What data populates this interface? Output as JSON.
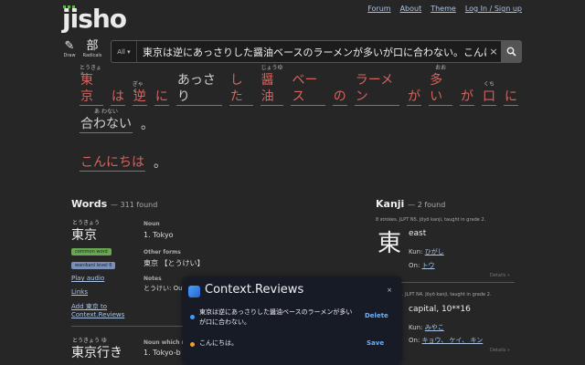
{
  "header": {
    "logo": "jisho",
    "nav": [
      "Forum",
      "About",
      "Theme",
      "Log In / Sign up"
    ],
    "draw_label": "Draw",
    "radicals_label": "Radicals",
    "draw_icon": "✎",
    "radicals_icon": "部"
  },
  "search": {
    "selector": "All ▾",
    "query": "東京は逆にあっさりした醤油ベースのラーメンが多いが口に合わない。こんにちは。",
    "clear": "×"
  },
  "sentence": {
    "line1": [
      {
        "furi": "とうきょう",
        "w": "東京",
        "style": "red"
      },
      {
        "furi": "",
        "w": "は",
        "style": "red"
      },
      {
        "furi": "ぎゃく",
        "w": "逆",
        "style": "red"
      },
      {
        "furi": "",
        "w": "に",
        "style": "red"
      },
      {
        "furi": "",
        "w": "あっさり",
        "style": "grey"
      },
      {
        "furi": "",
        "w": "した",
        "style": "red"
      },
      {
        "furi": "じょうゆ",
        "w": "醤油",
        "style": "red"
      },
      {
        "furi": "",
        "w": "ベース",
        "style": "red"
      },
      {
        "furi": "",
        "w": "の",
        "style": "red"
      },
      {
        "furi": "",
        "w": "ラーメン",
        "style": "red"
      },
      {
        "furi": "",
        "w": "が",
        "style": "red"
      },
      {
        "furi": "おお",
        "w": "多い",
        "style": "red"
      },
      {
        "furi": "",
        "w": "が",
        "style": "red"
      },
      {
        "furi": "くち",
        "w": "口",
        "style": "red"
      },
      {
        "furi": "",
        "w": "に",
        "style": "red"
      }
    ],
    "line2": [
      {
        "furi": "あ わない",
        "w": "合わない",
        "style": "grey"
      },
      {
        "furi": "",
        "w": "。",
        "style": "grey",
        "noline": true
      }
    ],
    "line3": [
      {
        "furi": "",
        "w": "こんにちは",
        "style": "red"
      },
      {
        "furi": "",
        "w": "。",
        "style": "grey",
        "noline": true
      }
    ]
  },
  "words": {
    "title": "Words",
    "count": "— 311 found",
    "entry1": {
      "furigana": "とうきょう",
      "word": "東京",
      "tag_common": "common word",
      "tag_wanikani": "wanikani level 6",
      "play_audio": "Play audio",
      "links": "Links",
      "add_link_1": "Add 東京 to",
      "add_link_2": "Context.Reviews",
      "pos_label": "Noun",
      "meaning": "1.  Tokyo",
      "other_forms_label": "Other forms",
      "other_forms": "東京 【とうけい】",
      "notes_label": "Notes",
      "notes": "とうけい: Out"
    },
    "entry2": {
      "furigana": "とうきょう  ゆ",
      "word": "東京行き",
      "pos_label": "Noun which m",
      "meaning": "1.  Tokyo-b"
    }
  },
  "kanji": {
    "title": "Kanji",
    "count": "— 2 found",
    "k1": {
      "info": "8 strokes. JLPT N5. Jōyō kanji, taught in grade 2.",
      "char": "東",
      "meaning": "east",
      "kun_label": "Kun:",
      "kun": "ひがし",
      "on_label": "On:",
      "on": "トウ",
      "details": "Details »"
    },
    "k2": {
      "info": ". JLPT N4. Jōyō kanji, taught in grade 2.",
      "meaning": "capital, 10**16",
      "kun_label": "Kun:",
      "kun": "みやこ",
      "on_label": "On:",
      "on": "キョウ、 ケイ、 キン",
      "details": "Details »"
    }
  },
  "popup": {
    "title": "Context.Reviews",
    "close": "×",
    "item1": "東京は逆にあっさりした醤油ベースのラーメンが多いが口に合わない。",
    "item1_action": "Delete",
    "item2": "こんにちは。",
    "item2_action": "Save",
    "colors": {
      "blue": "#3b9bff",
      "orange": "#f0a020"
    }
  }
}
